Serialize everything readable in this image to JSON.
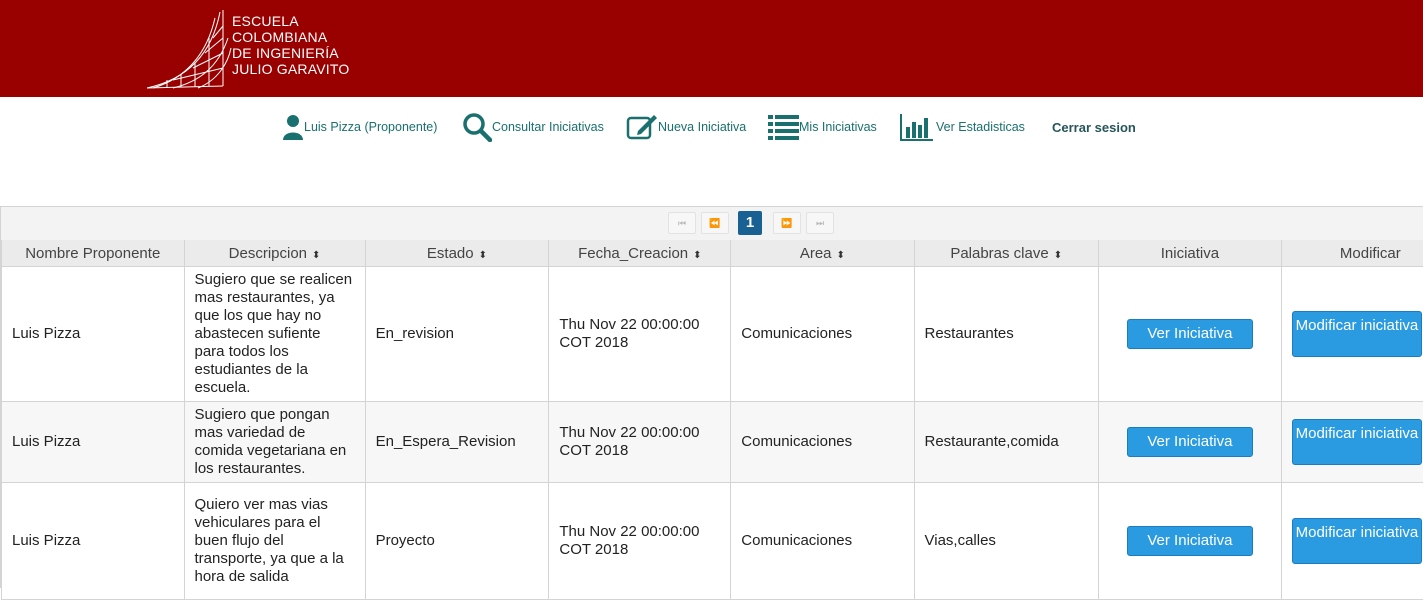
{
  "header": {
    "logo_lines": [
      "Escuela",
      "Colombiana",
      "de Ingeniería",
      "Julio Garavito"
    ],
    "brand_color": "#990000"
  },
  "nav": {
    "user": {
      "label": "Luis Pizza (Proponente)",
      "icon": "user-icon"
    },
    "consultar": {
      "label": "Consultar Iniciativas",
      "icon": "search-icon"
    },
    "nueva": {
      "label": "Nueva Iniciativa",
      "icon": "edit-icon"
    },
    "mis": {
      "label": "Mis Iniciativas",
      "icon": "list-icon"
    },
    "estadisticas": {
      "label": "Ver Estadisticas",
      "icon": "bar-chart-icon"
    },
    "cerrar": {
      "label": "Cerrar sesion"
    }
  },
  "pager": {
    "first": "⏮",
    "prev": "⏪",
    "current": "1",
    "next": "⏩",
    "last": "⏭"
  },
  "table": {
    "headers": [
      {
        "label": "Nombre Proponente",
        "sortable": false
      },
      {
        "label": "Descripcion",
        "sortable": true
      },
      {
        "label": "Estado",
        "sortable": true
      },
      {
        "label": "Fecha_Creacion",
        "sortable": true
      },
      {
        "label": "Area",
        "sortable": true
      },
      {
        "label": "Palabras clave",
        "sortable": true
      },
      {
        "label": "Iniciativa",
        "sortable": false
      },
      {
        "label": "Modificar",
        "sortable": false
      }
    ],
    "sort_glyph": "⬍",
    "rows": [
      {
        "nombre": "Luis Pizza",
        "descripcion": "Sugiero que se realicen mas restaurantes, ya que los que hay no abastecen sufiente para todos los estudiantes de la escuela.",
        "estado": "En_revision",
        "fecha": "Thu Nov 22 00:00:00 COT 2018",
        "area": "Comunicaciones",
        "palabras": "Restaurantes",
        "ver_label": "Ver Iniciativa",
        "mod_label": "Modificar iniciativa"
      },
      {
        "nombre": "Luis Pizza",
        "descripcion": "Sugiero que pongan mas variedad de comida vegetariana en los restaurantes.",
        "estado": "En_Espera_Revision",
        "fecha": "Thu Nov 22 00:00:00 COT 2018",
        "area": "Comunicaciones",
        "palabras": "Restaurante,comida",
        "ver_label": "Ver Iniciativa",
        "mod_label": "Modificar iniciativa"
      },
      {
        "nombre": "Luis Pizza",
        "descripcion": "Quiero ver mas vias vehiculares para el buen flujo del transporte, ya que a la hora de salida",
        "estado": "Proyecto",
        "fecha": "Thu Nov 22 00:00:00 COT 2018",
        "area": "Comunicaciones",
        "palabras": "Vias,calles",
        "ver_label": "Ver Iniciativa",
        "mod_label": "Modificar iniciativa"
      }
    ]
  },
  "colors": {
    "nav_text": "#1a6f6f",
    "button_blue": "#2a9be0",
    "pager_active": "#1a6193"
  }
}
